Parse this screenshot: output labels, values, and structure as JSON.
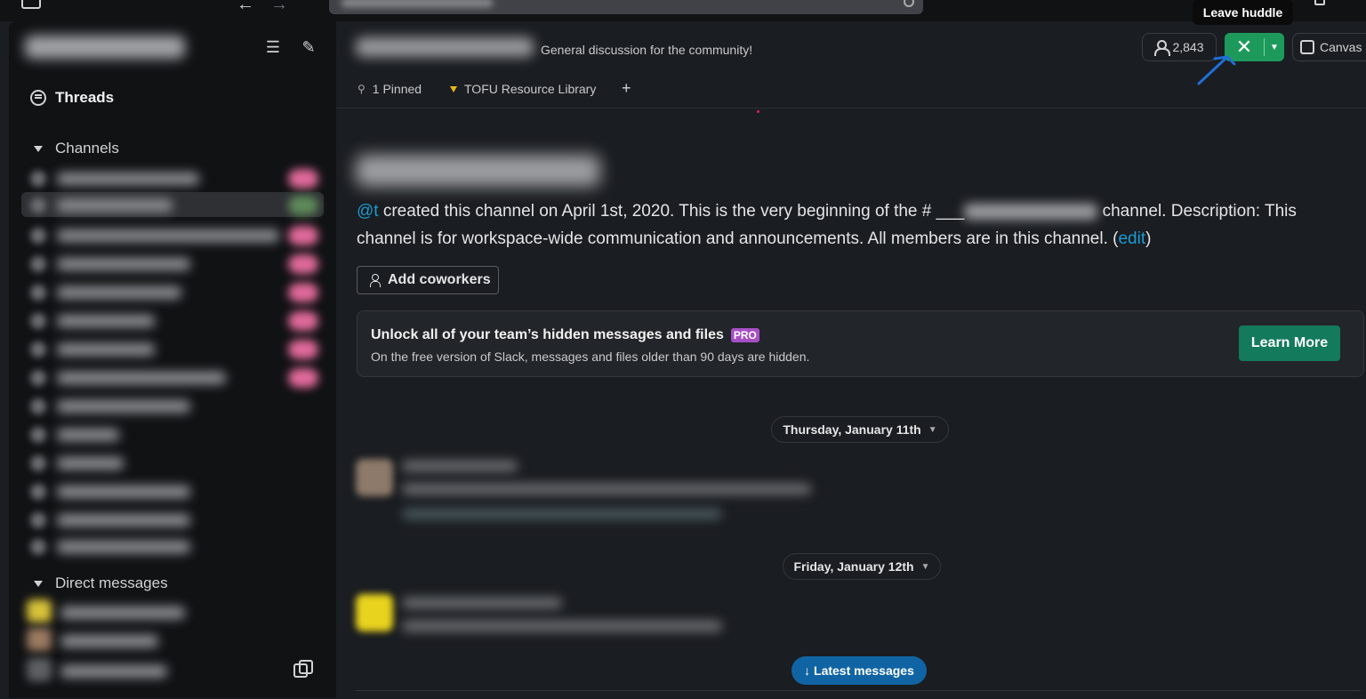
{
  "topbar": {
    "back": "←",
    "forward": "→"
  },
  "sidebar": {
    "threads_label": "Threads",
    "channels_section": "Channels",
    "dm_section": "Direct messages"
  },
  "channel": {
    "description": "General discussion for the community!",
    "members_count": "2,843",
    "huddle_tooltip": "Leave huddle",
    "canvas_label": "Canvas",
    "tabs": {
      "pinned": "1 Pinned",
      "library": "TOFU Resource Library",
      "add": "+"
    }
  },
  "intro": {
    "creator": "@t",
    "text_before": " created this channel on April 1st, 2020. This is the very beginning of the # ___",
    "text_after": " channel. Description: This channel is for workspace-wide communication and announcements. All members are in this channel. (",
    "edit": "edit",
    "close": ")",
    "add_coworkers": "Add coworkers"
  },
  "banner": {
    "title": "Unlock all of your team’s hidden messages and files",
    "pro": "PRO",
    "subtitle": "On the free version of Slack, messages and files older than 90 days are hidden.",
    "cta": "Learn More"
  },
  "dates": {
    "first": "Thursday, January 11th",
    "second": "Friday, January 12th"
  },
  "latest_messages": "↓ Latest messages",
  "colors": {
    "accent": "#1d9a5b",
    "link": "#1d9bd1",
    "cta": "#137a5b",
    "latest": "#1164a3",
    "pro": "#a64fc4"
  }
}
